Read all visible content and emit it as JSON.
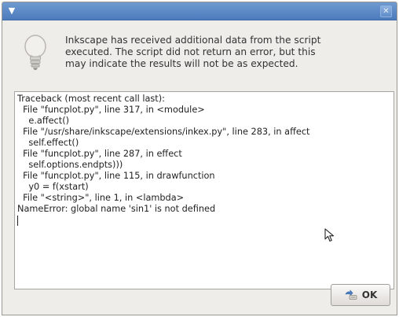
{
  "titlebar": {
    "menu_icon": "menu-arrow-icon",
    "close_icon": "close-icon",
    "close_glyph": "✕",
    "menu_glyph": "▼"
  },
  "message": {
    "icon": "lightbulb-icon",
    "lines": [
      "Inkscape has received additional data from the script",
      "executed.  The script did not return an error, but this",
      "may indicate the results will not be as expected."
    ]
  },
  "traceback": {
    "lines": [
      "Traceback (most recent call last):",
      "  File \"funcplot.py\", line 317, in <module>",
      "    e.affect()",
      "  File \"/usr/share/inkscape/extensions/inkex.py\", line 283, in affect",
      "    self.effect()",
      "  File \"funcplot.py\", line 287, in effect",
      "    self.options.endpts)))",
      "  File \"funcplot.py\", line 115, in drawfunction",
      "    y0 = f(xstart)",
      "  File \"<string>\", line 1, in <lambda>",
      "NameError: global name 'sin1' is not defined"
    ]
  },
  "buttons": {
    "ok_label": "OK",
    "ok_icon": "ok-icon"
  },
  "colors": {
    "titlebar": "#4c7bbd",
    "dialog_bg": "#efedea"
  }
}
